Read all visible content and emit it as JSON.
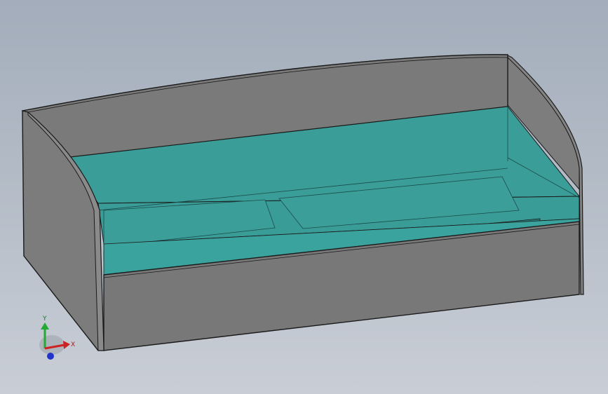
{
  "viewport": {
    "model": "bed-model",
    "colors": {
      "background_top": "#a3adbb",
      "background_bottom": "#c9ced6",
      "body_gray": "#7a7a7a",
      "body_gray_light": "#858585",
      "edge": "#1a1a1a",
      "glass": "#3aa7a0",
      "glass_dark": "#2f8c87"
    }
  },
  "triad": {
    "x_label": "X",
    "y_label": "Y",
    "x_color": "#cc2222",
    "y_color": "#22aa33",
    "z_color": "#2233cc"
  }
}
